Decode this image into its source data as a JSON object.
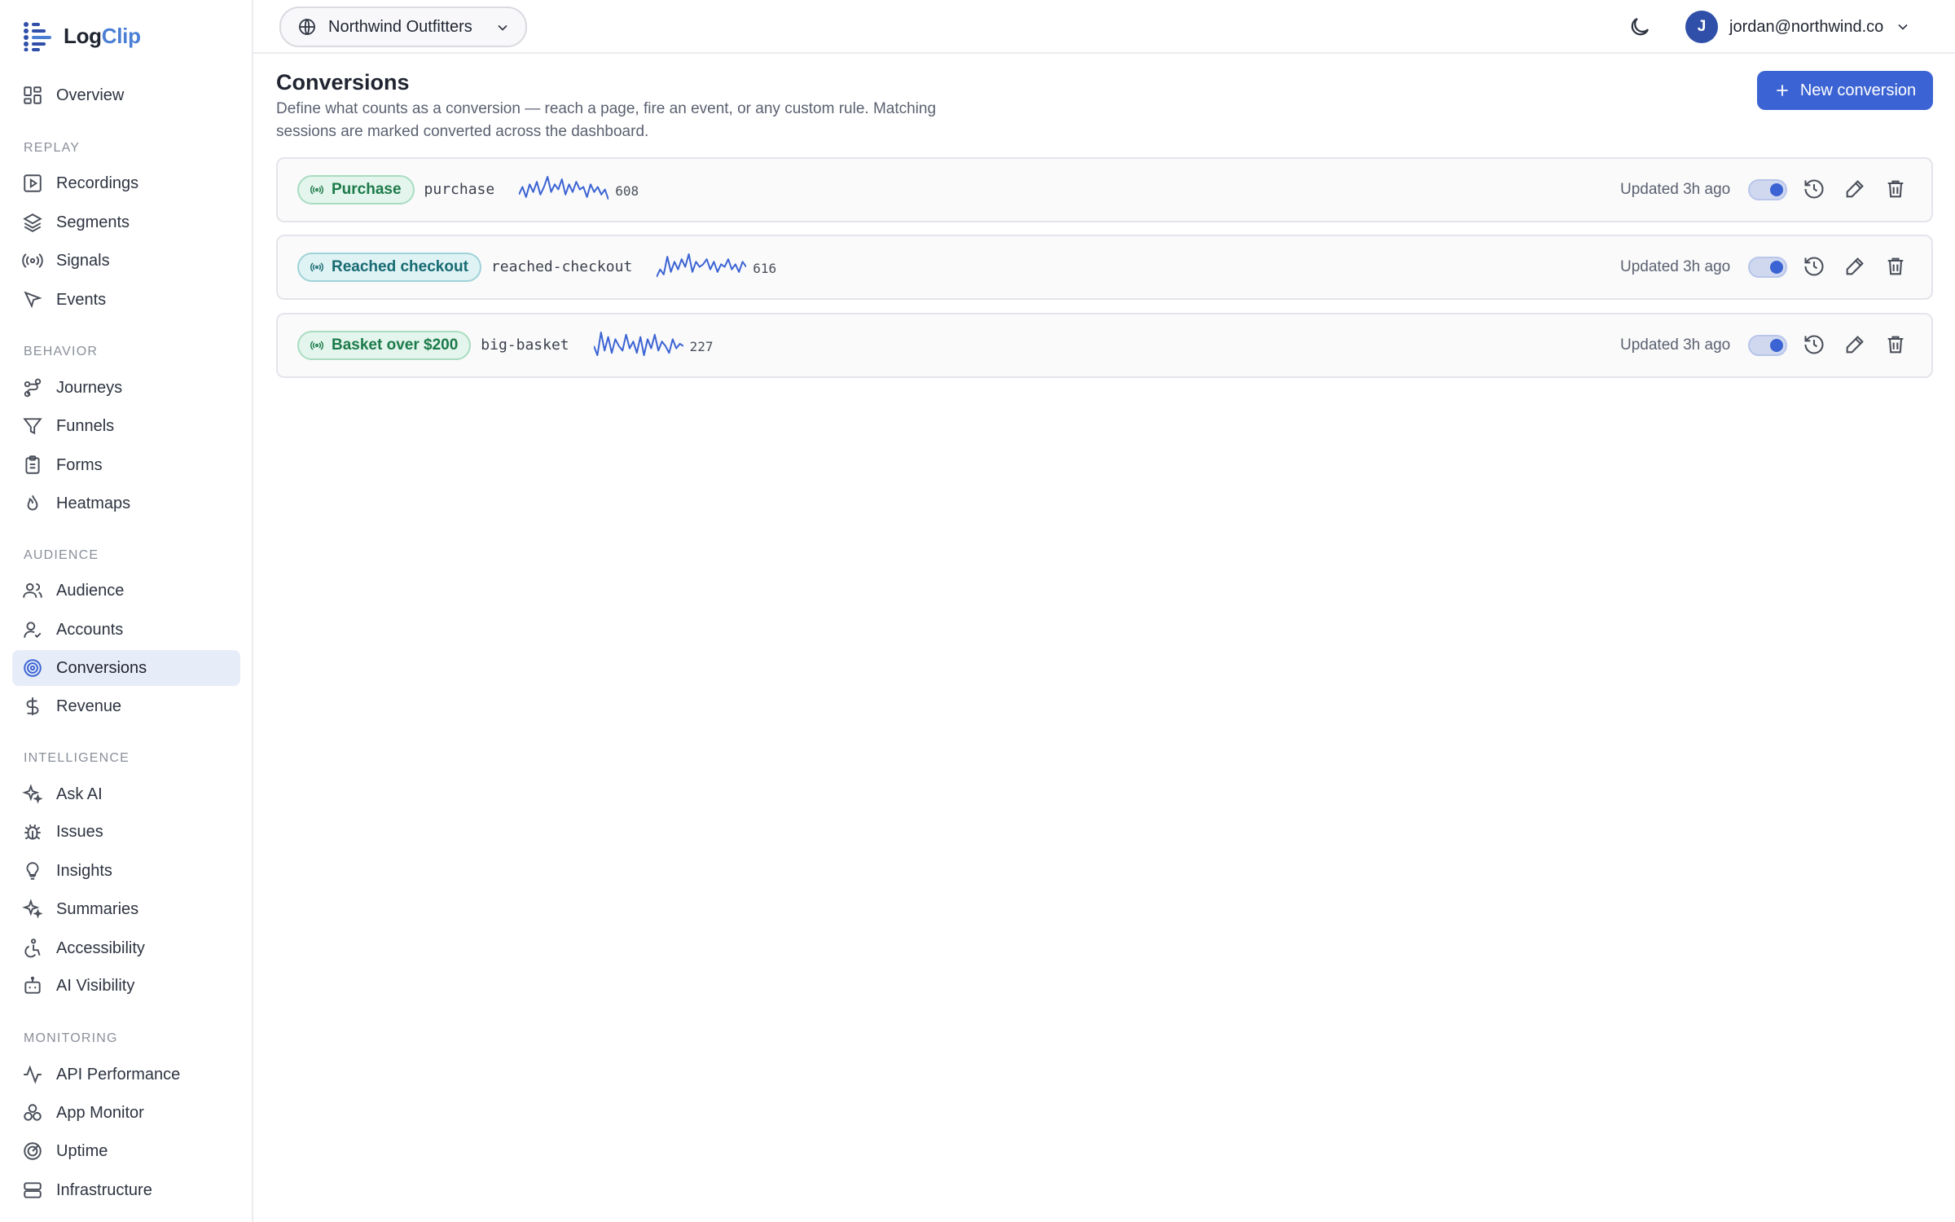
{
  "app": {
    "name_part1": "Log",
    "name_part2": "Clip",
    "brand_color": "#4a7fd4",
    "accent_color": "#3b63d3"
  },
  "sidebar": {
    "overview": "Overview",
    "sections": {
      "replay": "REPLAY",
      "behavior": "BEHAVIOR",
      "audience": "AUDIENCE",
      "intelligence": "INTELLIGENCE",
      "monitoring": "MONITORING"
    },
    "items": {
      "recordings": "Recordings",
      "segments": "Segments",
      "signals": "Signals",
      "events": "Events",
      "journeys": "Journeys",
      "funnels": "Funnels",
      "forms": "Forms",
      "heatmaps": "Heatmaps",
      "audience": "Audience",
      "accounts": "Accounts",
      "conversions": "Conversions",
      "revenue": "Revenue",
      "ask_ai": "Ask AI",
      "issues": "Issues",
      "insights": "Insights",
      "summaries": "Summaries",
      "accessibility": "Accessibility",
      "ai_visibility": "AI Visibility",
      "api_performance": "API Performance",
      "app_monitor": "App Monitor",
      "uptime": "Uptime",
      "infrastructure": "Infrastructure"
    },
    "active_item": "Conversions"
  },
  "topbar": {
    "workspace": "Northwind Outfitters",
    "user_initial": "J",
    "user_email": "jordan@northwind.co"
  },
  "page": {
    "title": "Conversions",
    "description": "Define what counts as a conversion — reach a page, fire an event, or any custom rule. Matching sessions are marked converted across the dashboard.",
    "new_button": "New conversion"
  },
  "conversions": [
    {
      "name": "Purchase",
      "slug": "purchase",
      "count": "608",
      "updated": "Updated 3h ago",
      "enabled": true,
      "badge_color": "green",
      "sparkline": [
        5,
        8,
        4,
        9,
        6,
        10,
        5,
        8,
        12,
        6,
        9,
        7,
        11,
        5,
        9,
        6,
        10,
        7,
        8,
        4,
        9,
        6,
        8,
        5,
        7,
        3
      ]
    },
    {
      "name": "Reached checkout",
      "slug": "reached-checkout",
      "count": "616",
      "updated": "Updated 3h ago",
      "enabled": true,
      "badge_color": "teal",
      "sparkline": [
        4,
        7,
        5,
        12,
        6,
        10,
        7,
        11,
        8,
        13,
        6,
        10,
        8,
        9,
        11,
        7,
        10,
        6,
        9,
        8,
        11,
        7,
        9,
        6,
        10,
        8
      ]
    },
    {
      "name": "Basket over $200",
      "slug": "big-basket",
      "count": "227",
      "updated": "Updated 3h ago",
      "enabled": true,
      "badge_color": "green",
      "sparkline": [
        6,
        2,
        12,
        4,
        10,
        3,
        9,
        6,
        4,
        11,
        5,
        8,
        3,
        10,
        2,
        9,
        5,
        11,
        4,
        8,
        6,
        3,
        9,
        5,
        7,
        6
      ]
    }
  ]
}
